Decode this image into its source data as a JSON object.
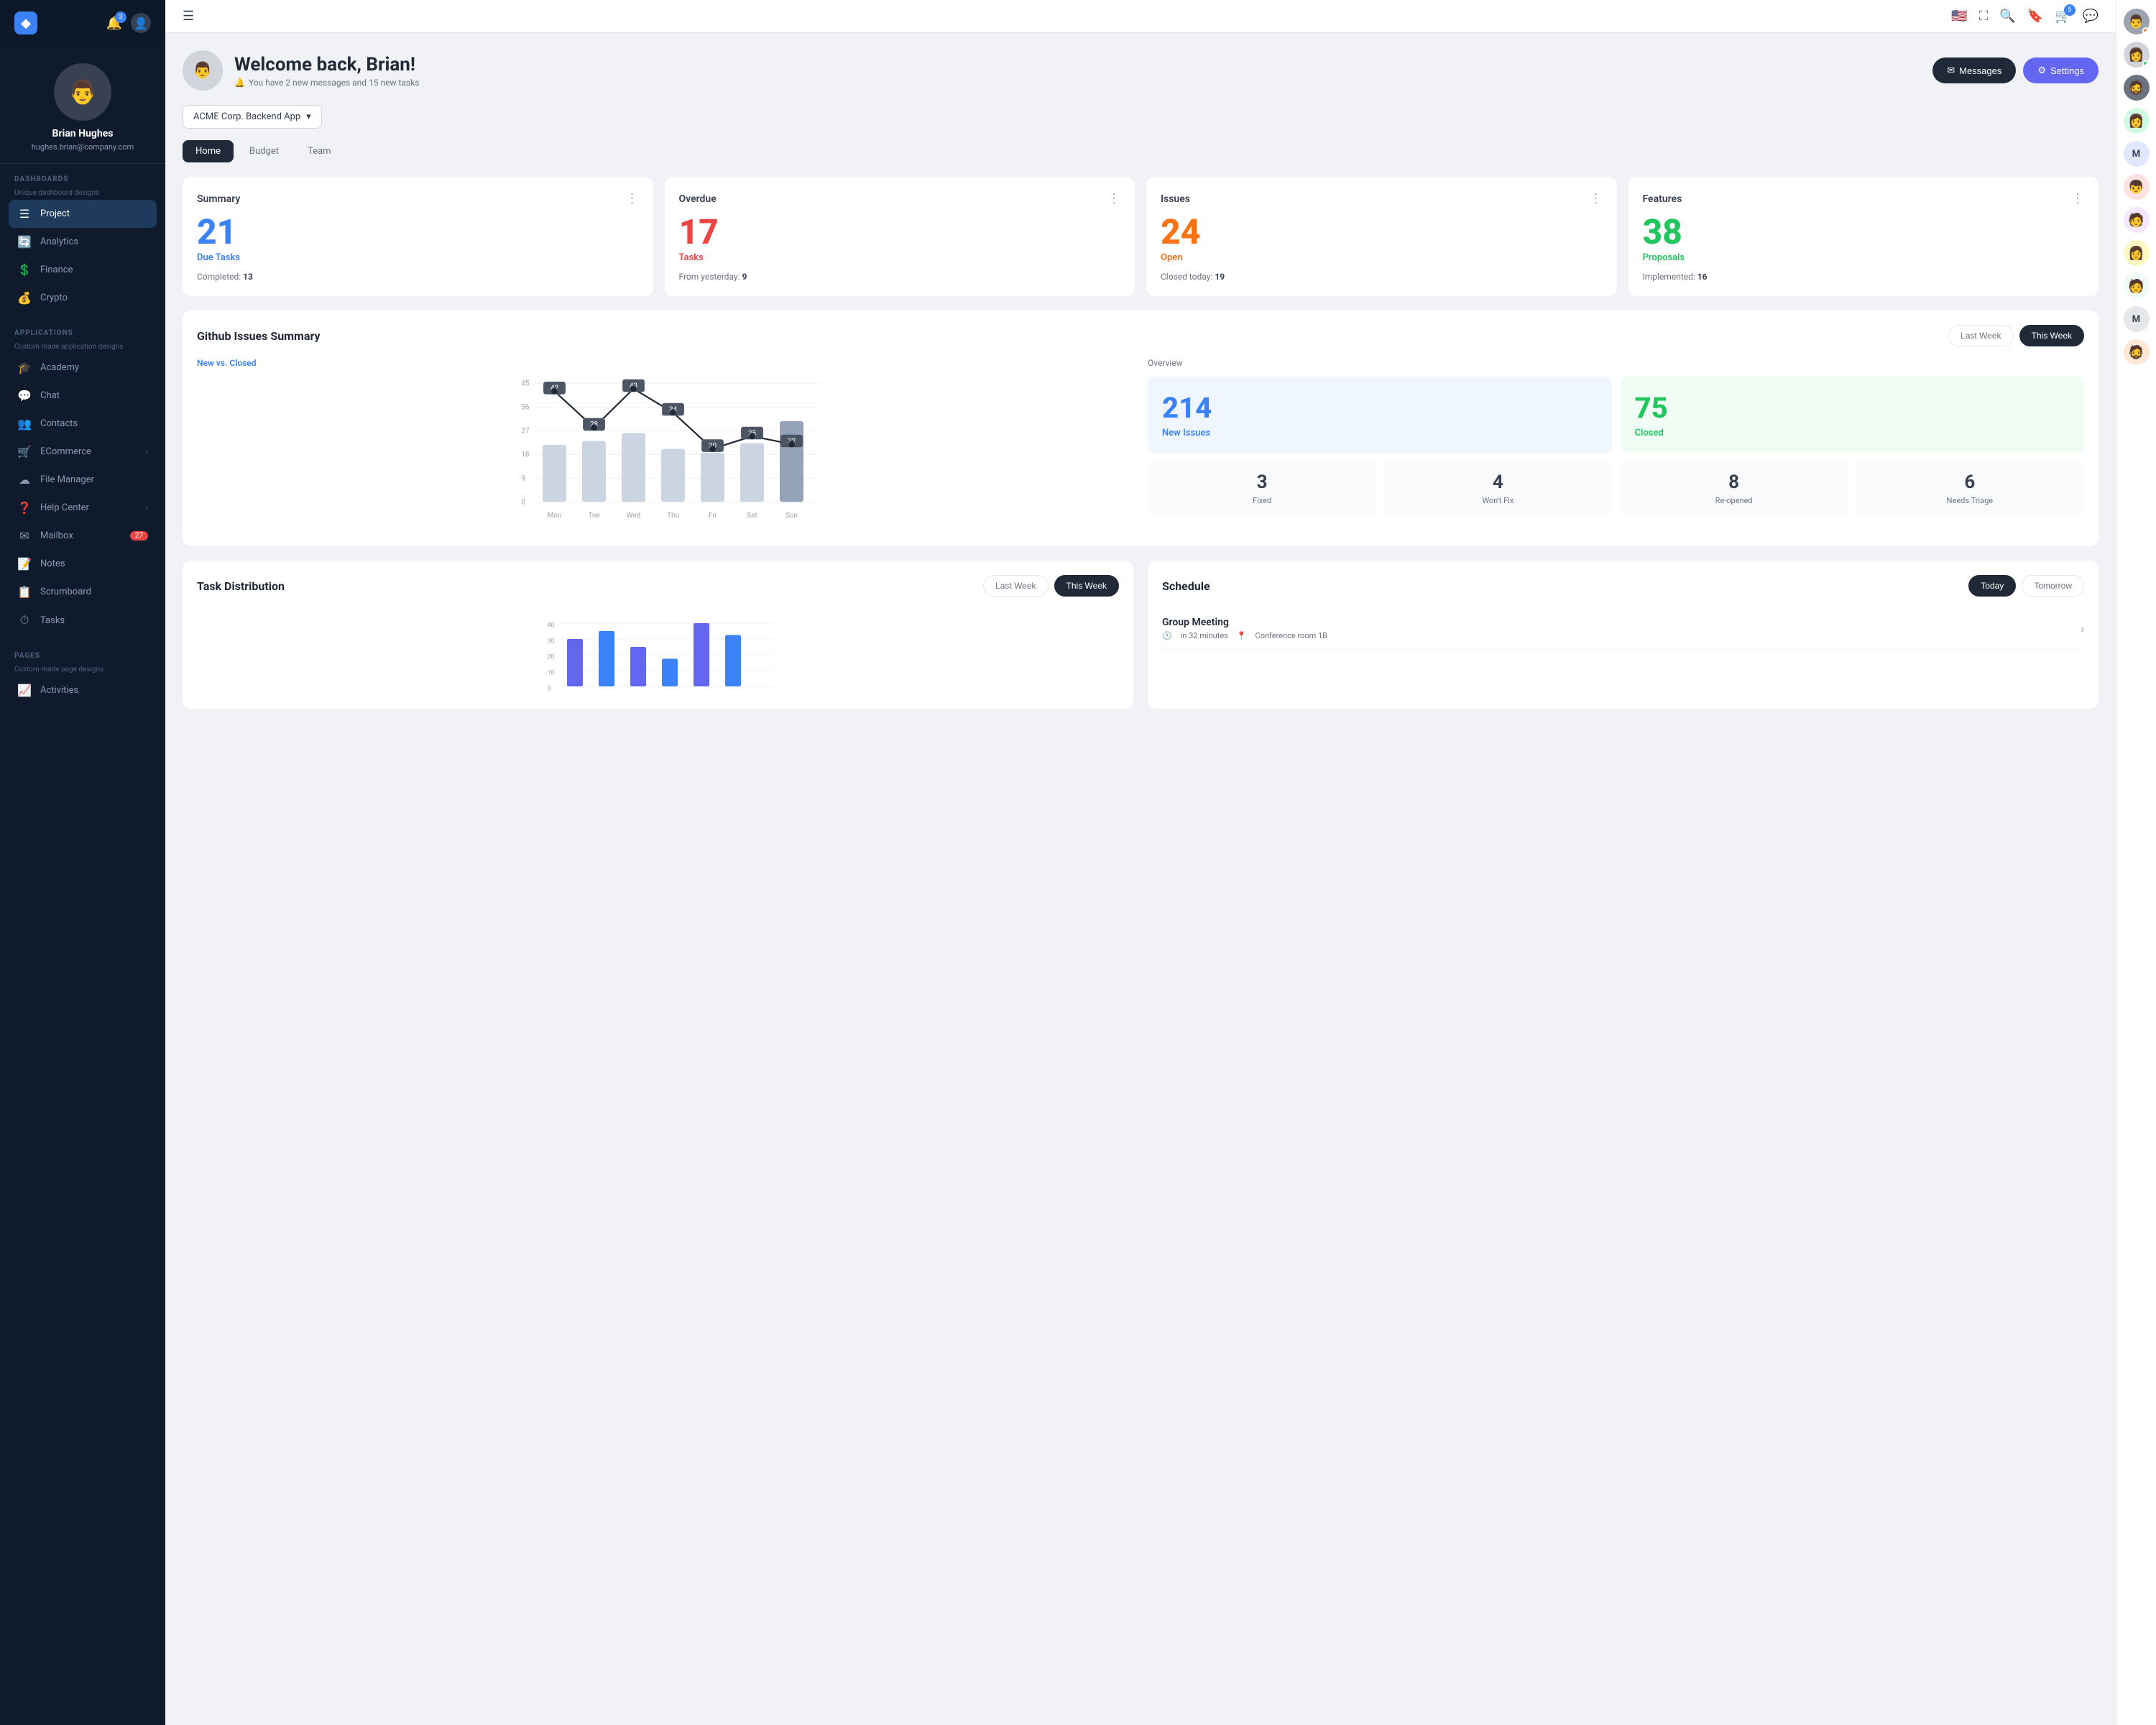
{
  "sidebar": {
    "logo": "◆",
    "notifications_count": "3",
    "profile": {
      "name": "Brian Hughes",
      "email": "hughes.brian@company.com",
      "avatar_emoji": "👨"
    },
    "sections": [
      {
        "title": "DASHBOARDS",
        "subtitle": "Unique dashboard designs",
        "items": [
          {
            "label": "Project",
            "icon": "☰",
            "active": true
          },
          {
            "label": "Analytics",
            "icon": "🔄"
          },
          {
            "label": "Finance",
            "icon": "💲"
          },
          {
            "label": "Crypto",
            "icon": "💰"
          }
        ]
      },
      {
        "title": "APPLICATIONS",
        "subtitle": "Custom made application designs",
        "items": [
          {
            "label": "Academy",
            "icon": "🎓"
          },
          {
            "label": "Chat",
            "icon": "💬"
          },
          {
            "label": "Contacts",
            "icon": "👥"
          },
          {
            "label": "ECommerce",
            "icon": "🛒",
            "chevron": true
          },
          {
            "label": "File Manager",
            "icon": "☁"
          },
          {
            "label": "Help Center",
            "icon": "❓",
            "chevron": true
          },
          {
            "label": "Mailbox",
            "icon": "✉",
            "badge": "27"
          },
          {
            "label": "Notes",
            "icon": "📝"
          },
          {
            "label": "Scrumboard",
            "icon": "📋"
          },
          {
            "label": "Tasks",
            "icon": "⏱"
          }
        ]
      },
      {
        "title": "PAGES",
        "subtitle": "Custom made page designs",
        "items": [
          {
            "label": "Activities",
            "icon": "📈"
          }
        ]
      }
    ]
  },
  "topbar": {
    "flag": "🇺🇸",
    "cart_badge": "5"
  },
  "welcome": {
    "title": "Welcome back, Brian!",
    "subtitle": "You have 2 new messages and 15 new tasks",
    "messages_btn": "Messages",
    "settings_btn": "Settings"
  },
  "project_selector": {
    "label": "ACME Corp. Backend App"
  },
  "tabs": [
    {
      "label": "Home",
      "active": true
    },
    {
      "label": "Budget"
    },
    {
      "label": "Team"
    }
  ],
  "cards": [
    {
      "title": "Summary",
      "number": "21",
      "number_color": "blue",
      "label": "Due Tasks",
      "label_color": "blue",
      "sub_key": "Completed:",
      "sub_val": "13"
    },
    {
      "title": "Overdue",
      "number": "17",
      "number_color": "red",
      "label": "Tasks",
      "label_color": "red",
      "sub_key": "From yesterday:",
      "sub_val": "9"
    },
    {
      "title": "Issues",
      "number": "24",
      "number_color": "orange",
      "label": "Open",
      "label_color": "orange",
      "sub_key": "Closed today:",
      "sub_val": "19"
    },
    {
      "title": "Features",
      "number": "38",
      "number_color": "green",
      "label": "Proposals",
      "label_color": "green",
      "sub_key": "Implemented:",
      "sub_val": "16"
    }
  ],
  "github": {
    "title": "Github Issues Summary",
    "toggle_last": "Last Week",
    "toggle_this": "This Week",
    "chart": {
      "label": "New vs. Closed",
      "days": [
        "Mon",
        "Tue",
        "Wed",
        "Thu",
        "Fri",
        "Sat",
        "Sun"
      ],
      "line_values": [
        42,
        28,
        43,
        34,
        20,
        25,
        22
      ],
      "bar_heights": [
        0.75,
        0.65,
        0.8,
        0.55,
        0.45,
        0.6,
        0.9
      ],
      "y_labels": [
        "45",
        "36",
        "27",
        "18",
        "9",
        "0"
      ]
    },
    "overview": {
      "label": "Overview",
      "new_issues_num": "214",
      "new_issues_label": "New Issues",
      "closed_num": "75",
      "closed_label": "Closed",
      "mini_cards": [
        {
          "num": "3",
          "label": "Fixed"
        },
        {
          "num": "4",
          "label": "Won't Fix"
        },
        {
          "num": "8",
          "label": "Re-opened"
        },
        {
          "num": "6",
          "label": "Needs Triage"
        }
      ]
    }
  },
  "task_distribution": {
    "title": "Task Distribution",
    "toggle_last": "Last Week",
    "toggle_this": "This Week"
  },
  "schedule": {
    "title": "Schedule",
    "toggle_today": "Today",
    "toggle_tomorrow": "Tomorrow",
    "items": [
      {
        "title": "Group Meeting",
        "time": "in 32 minutes",
        "location": "Conference room 1B"
      }
    ]
  },
  "right_panel": {
    "avatars": [
      {
        "type": "image",
        "bg": "#9ca3af",
        "text": "👨",
        "badge": "orange"
      },
      {
        "type": "text",
        "bg": "#d1d5db",
        "text": "👩",
        "badge": ""
      },
      {
        "type": "text",
        "bg": "#6b7280",
        "text": "🧔",
        "badge": ""
      },
      {
        "type": "text",
        "bg": "#d1fae5",
        "text": "👩",
        "badge": ""
      },
      {
        "type": "text",
        "bg": "#e0e7ff",
        "text": "M",
        "badge": ""
      },
      {
        "type": "text",
        "bg": "#fee2e2",
        "text": "👦",
        "badge": ""
      },
      {
        "type": "text",
        "bg": "#f3e8ff",
        "text": "🧑",
        "badge": ""
      },
      {
        "type": "text",
        "bg": "#fef9c3",
        "text": "👩",
        "badge": ""
      },
      {
        "type": "text",
        "bg": "#f0fdf4",
        "text": "🧑",
        "badge": ""
      },
      {
        "type": "text",
        "bg": "#d1d5db",
        "text": "M",
        "badge": ""
      },
      {
        "type": "text",
        "bg": "#fee2e2",
        "text": "🧔",
        "badge": ""
      }
    ]
  }
}
